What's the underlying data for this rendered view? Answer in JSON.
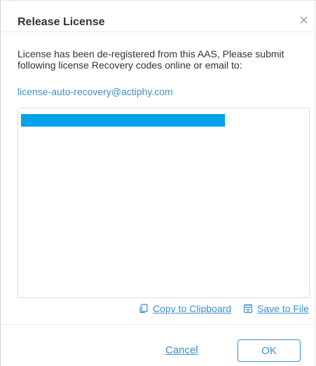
{
  "dialog": {
    "title": "Release License",
    "close_icon": "close-icon",
    "message": "License has been de-registered from this AAS, Please submit following license Recovery codes online or email to:",
    "email": "license-auto-recovery@actiphy.com",
    "recovery_codes": "",
    "copy_label": "Copy to Clipboard",
    "copy_icon": "copy-icon",
    "save_label": "Save to File",
    "save_icon": "save-icon",
    "cancel_label": "Cancel",
    "ok_label": "OK"
  },
  "colors": {
    "accent": "#3b8fd0",
    "selection": "#00a2e8",
    "text": "#333333",
    "border": "#d5dde5"
  }
}
